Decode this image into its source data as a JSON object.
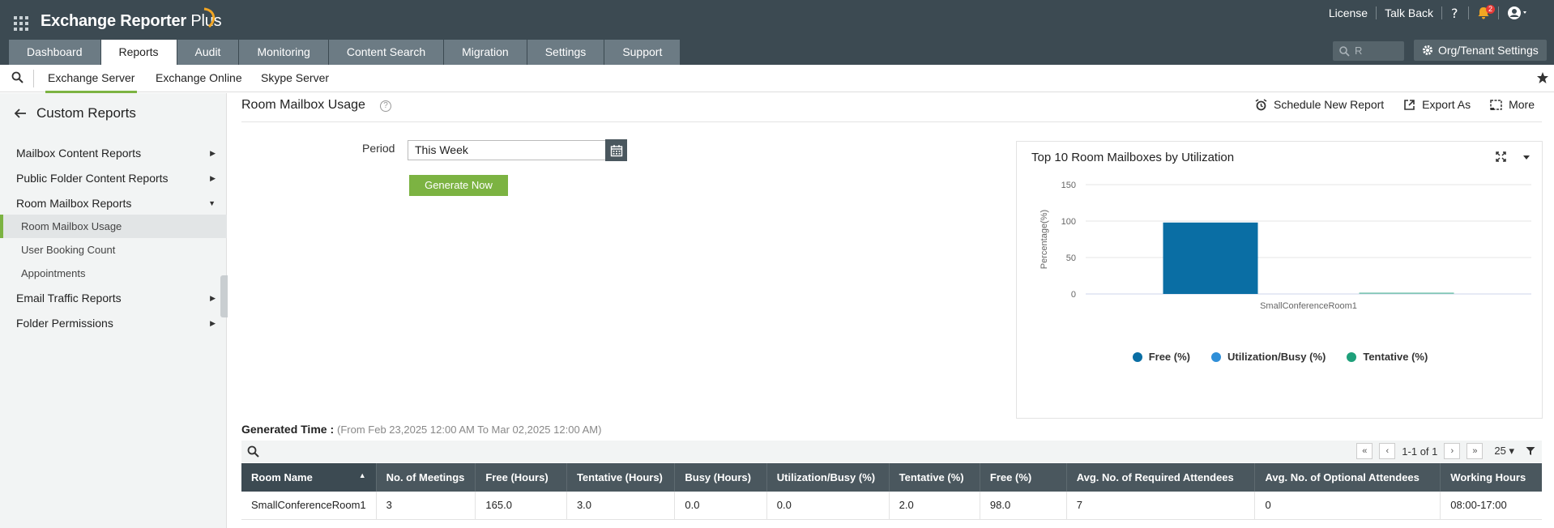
{
  "app": {
    "title": "Exchange Reporter",
    "title_suffix": "Plus",
    "top_links": [
      "License",
      "Talk Back"
    ],
    "notification_count": "2"
  },
  "tabs": [
    "Dashboard",
    "Reports",
    "Audit",
    "Monitoring",
    "Content Search",
    "Migration",
    "Settings",
    "Support"
  ],
  "active_tab": "Reports",
  "top_search_placeholder": "R",
  "org_button": "Org/Tenant Settings",
  "subnav": [
    "Exchange Server",
    "Exchange Online",
    "Skype Server"
  ],
  "sidebar": {
    "title": "Custom Reports",
    "items": [
      "Mailbox Content Reports",
      "Public Folder Content Reports",
      "Room Mailbox Reports",
      "Email Traffic Reports",
      "Folder Permissions"
    ],
    "subitems": [
      "Room Mailbox Usage",
      "User Booking Count",
      "Appointments"
    ]
  },
  "page": {
    "title": "Room Mailbox Usage",
    "actions": [
      "Schedule New Report",
      "Export As",
      "More"
    ],
    "period_label": "Period",
    "period_value": "This Week",
    "generate_button": "Generate Now",
    "generated_label": "Generated Time :",
    "generated_range": "(From Feb 23,2025 12:00 AM To Mar 02,2025 12:00 AM)"
  },
  "pager": {
    "range": "1-1 of 1",
    "page_size": "25"
  },
  "table": {
    "columns": [
      "Room Name",
      "No. of Meetings",
      "Free (Hours)",
      "Tentative (Hours)",
      "Busy (Hours)",
      "Utilization/Busy (%)",
      "Tentative (%)",
      "Free (%)",
      "Avg. No. of Required Attendees",
      "Avg. No. of Optional Attendees",
      "Working Hours"
    ],
    "rows": [
      [
        "SmallConferenceRoom1",
        "3",
        "165.0",
        "3.0",
        "0.0",
        "0.0",
        "2.0",
        "98.0",
        "7",
        "0",
        "08:00-17:00"
      ]
    ]
  },
  "chart_data": {
    "type": "bar",
    "title": "Top 10 Room Mailboxes by Utilization",
    "ylabel": "Percentage(%)",
    "xlabel": "",
    "ylim": [
      0,
      150
    ],
    "yticks": [
      0,
      50,
      100,
      150
    ],
    "categories": [
      "SmallConferenceRoom1"
    ],
    "series": [
      {
        "name": "Free (%)",
        "values": [
          98.0
        ],
        "color": "#0a6ea4"
      },
      {
        "name": "Utilization/Busy (%)",
        "values": [
          0.0
        ],
        "color": "#2f8fd8"
      },
      {
        "name": "Tentative (%)",
        "values": [
          2.0
        ],
        "color": "#1ea07a"
      }
    ],
    "grid": true,
    "legend": "bottom"
  }
}
